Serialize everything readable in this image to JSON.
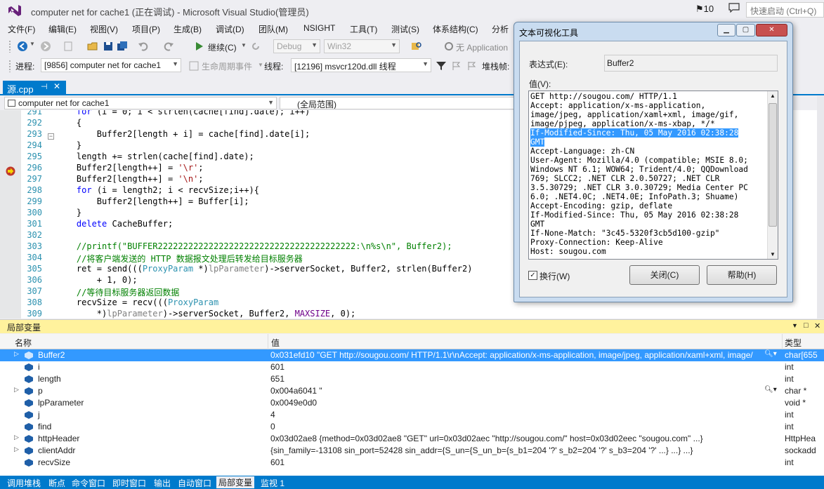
{
  "window": {
    "title": "computer net for cache1 (正在调试) - Microsoft Visual Studio(管理员)",
    "notifications": "10",
    "quick_launch_placeholder": "快速启动 (Ctrl+Q)"
  },
  "menu": [
    "文件(F)",
    "编辑(E)",
    "视图(V)",
    "项目(P)",
    "生成(B)",
    "调试(D)",
    "团队(M)",
    "NSIGHT",
    "工具(T)",
    "测试(S)",
    "体系结构(C)",
    "分析"
  ],
  "toolbar": {
    "continue_label": "继续(C)",
    "config": "Debug",
    "platform": "Win32",
    "application_label": "无 Application"
  },
  "debug_location": {
    "process_label": "进程:",
    "process": "[9856] computer net for cache1",
    "lifecycle_label": "生命周期事件",
    "thread_label": "线程:",
    "thread": "[12196] msvcr120d.dll 线程",
    "stack_label": "堆栈帧:"
  },
  "editor": {
    "tab": "源.cpp",
    "nav_scope": "computer net for cache1",
    "nav_member": "(全局范围)",
    "current_line": "306"
  },
  "locals": {
    "title": "局部变量",
    "columns": {
      "name": "名称",
      "value": "值",
      "type": "类型"
    },
    "rows": [
      {
        "name": "Buffer2",
        "value": "0x031efd10 \"GET http://sougou.com/ HTTP/1.1\\r\\nAccept: application/x-ms-application, image/jpeg, application/xaml+xml, image/",
        "type": "char[655",
        "expand": true,
        "selected": true,
        "magnifier": true
      },
      {
        "name": "i",
        "value": "601",
        "type": "int"
      },
      {
        "name": "length",
        "value": "651",
        "type": "int"
      },
      {
        "name": "p",
        "value": "0x004a6041 \"",
        "type": "char *",
        "expand": true,
        "magnifier": true
      },
      {
        "name": "lpParameter",
        "value": "0x0049e0d0",
        "type": "void *"
      },
      {
        "name": "j",
        "value": "4",
        "type": "int"
      },
      {
        "name": "find",
        "value": "0",
        "type": "int"
      },
      {
        "name": "httpHeader",
        "value": "0x03d02ae8 {method=0x03d02ae8 \"GET\" url=0x03d02aec \"http://sougou.com/\" host=0x03d02eec \"sougou.com\" ...}",
        "type": "HttpHea",
        "expand": true
      },
      {
        "name": "clientAddr",
        "value": "{sin_family=-13108 sin_port=52428 sin_addr={S_un={S_un_b={s_b1=204 '?' s_b2=204 '?' s_b3=204 '?' ...} ...} ...}",
        "type": "sockadd",
        "expand": true
      },
      {
        "name": "recvSize",
        "value": "601",
        "type": "int"
      }
    ]
  },
  "bottom_tabs": [
    "调用堆栈",
    "断点",
    "命令窗口",
    "即时窗口",
    "输出",
    "自动窗口",
    "局部变量",
    "监视 1"
  ],
  "dialog": {
    "title": "文本可视化工具",
    "expr_label": "表达式(E):",
    "expr_value": "Buffer2",
    "value_label": "值(V):",
    "lines": [
      "GET http://sougou.com/ HTTP/1.1",
      "Accept: application/x-ms-application,",
      "image/jpeg, application/xaml+xml, image/gif,",
      "image/pjpeg, application/x-ms-xbap, */*",
      "If-Modified-Since: Thu, 05 May 2016 02:38:28",
      "GMT",
      "Accept-Language: zh-CN",
      "User-Agent: Mozilla/4.0 (compatible; MSIE 8.0;",
      "Windows NT 6.1; WOW64; Trident/4.0; QQDownload",
      "769; SLCC2; .NET CLR 2.0.50727; .NET CLR",
      "3.5.30729; .NET CLR 3.0.30729; Media Center PC",
      "6.0; .NET4.0C; .NET4.0E; InfoPath.3; Shuame)",
      "Accept-Encoding: gzip, deflate",
      "If-Modified-Since: Thu, 05 May 2016 02:38:28",
      "GMT",
      "If-None-Match: \"3c45-5320f3cb5d100-gzip\"",
      "Proxy-Connection: Keep-Alive",
      "Host: sougou.com"
    ],
    "highlighted": [
      4,
      5
    ],
    "wrap_label": "换行(W)",
    "wrap_checked": "✓",
    "close_label": "关闭(C)",
    "help_label": "帮助(H)"
  },
  "colors": {
    "accent": "#007acc",
    "locals_header": "#fff29d",
    "selection": "#3399ff"
  }
}
